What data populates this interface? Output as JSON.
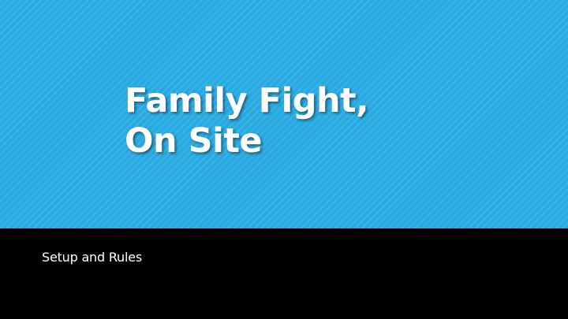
{
  "slide": {
    "title_line1": "Family Fight,",
    "title_line2": "On Site",
    "subtitle": "Setup and Rules"
  },
  "colors": {
    "title_panel": "#27a9e1",
    "subtitle_panel": "#000000",
    "text": "#ffffff"
  }
}
